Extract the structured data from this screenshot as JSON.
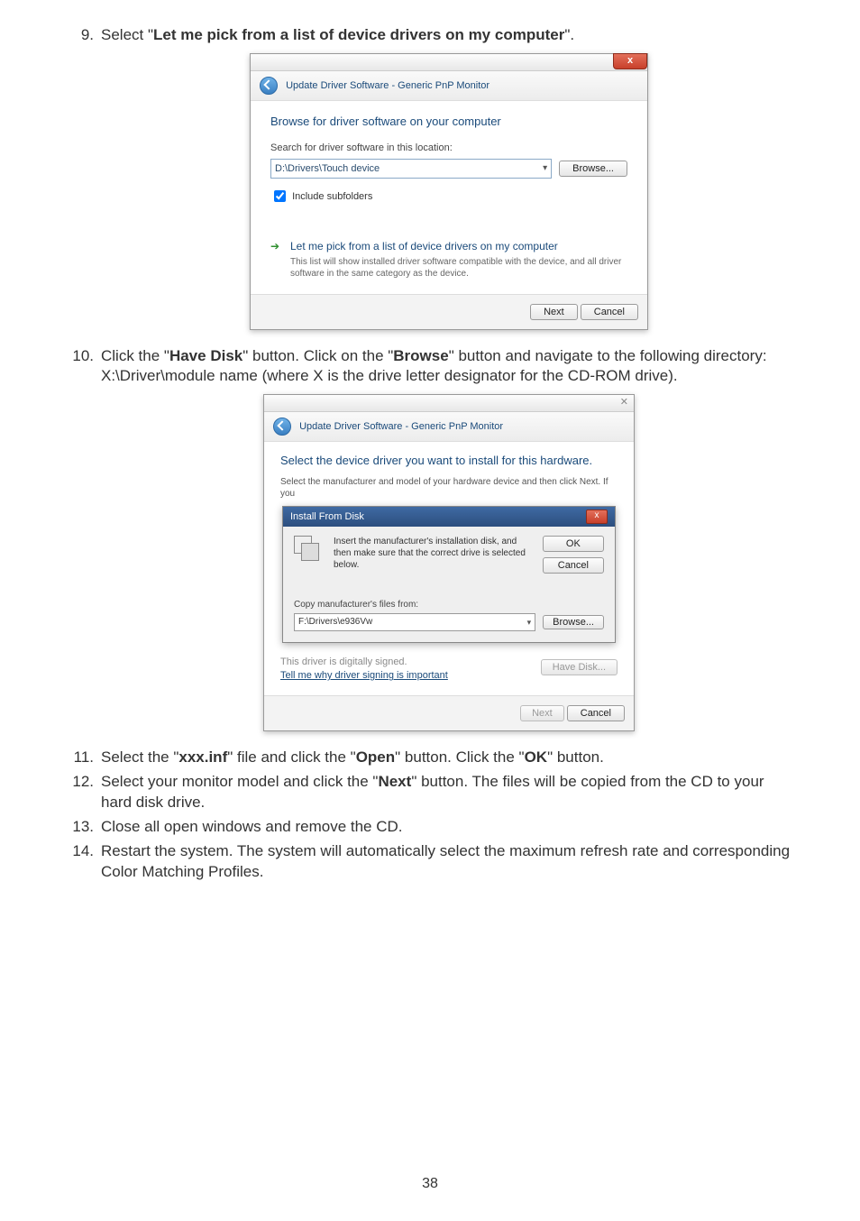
{
  "steps": {
    "s9": {
      "num": "9.",
      "prefix": "Select \"",
      "bold": "Let me pick from a list of device drivers on my computer",
      "suffix": "\"."
    },
    "s10": {
      "num": "10.",
      "line1_a": "Click the \"",
      "line1_b": "Have Disk",
      "line1_c": "\" button. Click on the \"",
      "line1_d": "Browse",
      "line1_e": "\" button and navigate to the following directory:",
      "line2": "X:\\Driver\\module name (where X is the drive letter designator for the CD-ROM drive)."
    },
    "s11": {
      "num": "11.",
      "a": "Select the \"",
      "b": "xxx.inf",
      "c": "\" file and click the \"",
      "d": "Open",
      "e": "\" button. Click the \"",
      "f": "OK",
      "g": "\" button."
    },
    "s12": {
      "num": "12.",
      "a": "Select your monitor model and click the \"",
      "b": "Next",
      "c": "\" button. The files will be copied from the CD to your hard disk drive."
    },
    "s13": {
      "num": "13.",
      "text": "Close all open windows and remove the CD."
    },
    "s14": {
      "num": "14.",
      "text": "Restart the system. The system will automatically select the maximum refresh rate and corresponding Color Matching Profiles."
    }
  },
  "win1": {
    "close_x": "x",
    "crumb": "Update Driver Software - Generic PnP Monitor",
    "heading": "Browse for driver software on your computer",
    "search_label": "Search for driver software in this location:",
    "path": "D:\\Drivers\\Touch device",
    "browse": "Browse...",
    "include": "Include subfolders",
    "opt_title": "Let me pick from a list of device drivers on my computer",
    "opt_desc": "This list will show installed driver software compatible with the device, and all driver software in the same category as the device.",
    "next": "Next",
    "cancel": "Cancel"
  },
  "win2": {
    "close_x": "✕",
    "crumb": "Update Driver Software - Generic PnP Monitor",
    "heading": "Select the device driver you want to install for this hardware.",
    "sub": "Select the manufacturer and model of your hardware device and then click Next. If you",
    "ifd_title": "Install From Disk",
    "ifd_close": "x",
    "ifd_msg": "Insert the manufacturer's installation disk, and then make sure that the correct drive is selected below.",
    "ok": "OK",
    "cancel": "Cancel",
    "copy_label": "Copy manufacturer's files from:",
    "copy_path": "F:\\Drivers\\e936Vw",
    "browse": "Browse...",
    "signed": "This driver is digitally signed.",
    "tell": "Tell me why driver signing is important",
    "havedisk": "Have Disk...",
    "next": "Next"
  },
  "page_number": "38"
}
